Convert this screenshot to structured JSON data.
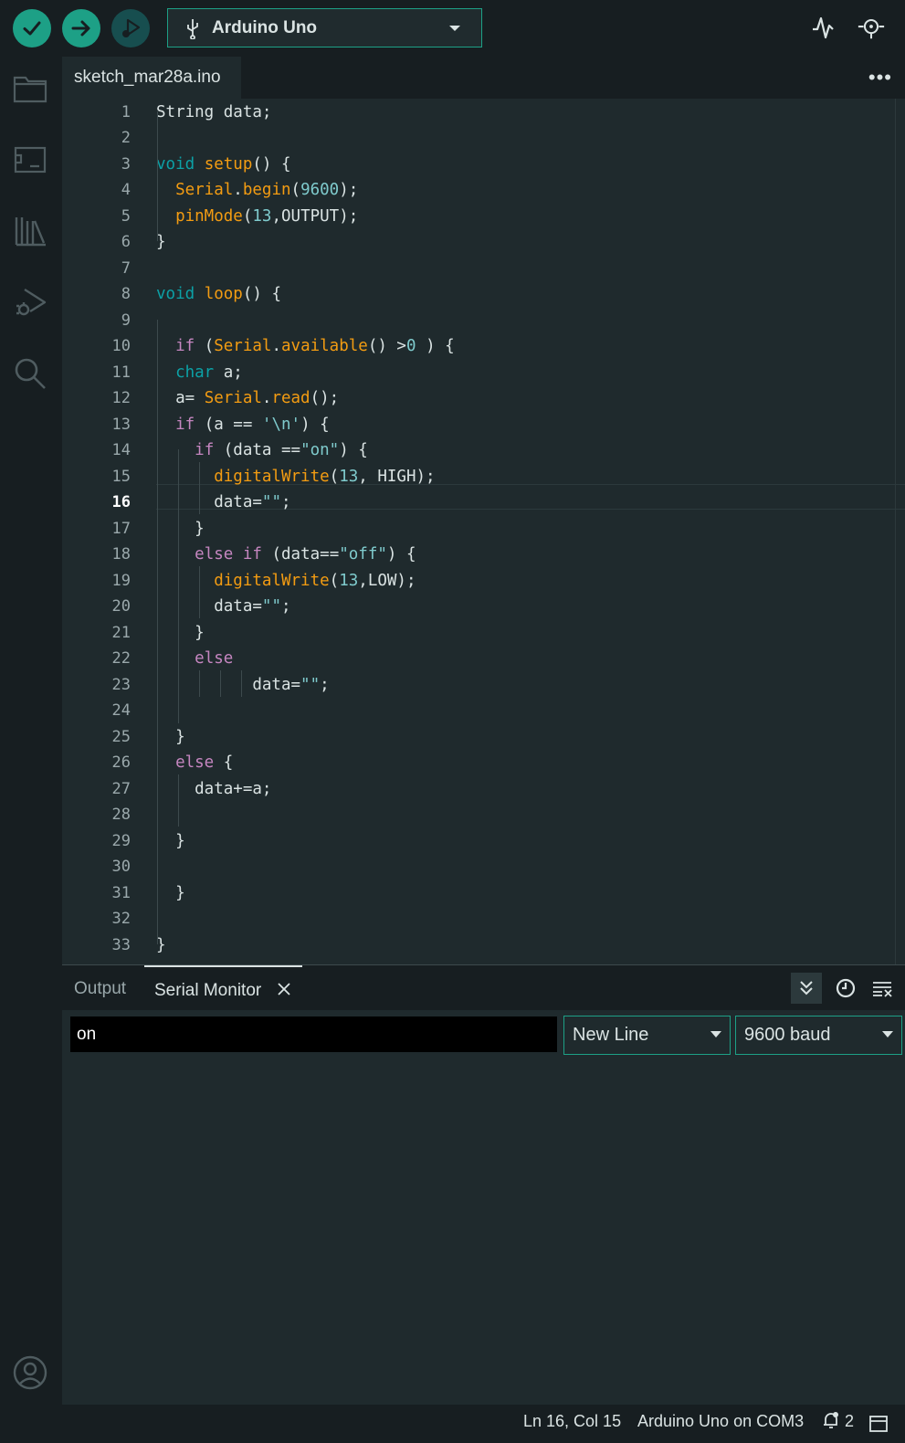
{
  "toolbar": {
    "verify_icon": "check-icon",
    "upload_icon": "arrow-right-icon",
    "debug_icon": "debug-icon",
    "board_icon": "usb-icon",
    "board_label": "Arduino Uno",
    "serial_plotter_icon": "serial-plotter-icon",
    "serial_monitor_icon": "serial-monitor-icon"
  },
  "sidebar": {
    "items": [
      {
        "icon": "folder-icon"
      },
      {
        "icon": "board-manager-icon"
      },
      {
        "icon": "library-icon"
      },
      {
        "icon": "debug-icon"
      },
      {
        "icon": "search-icon"
      }
    ],
    "profile_icon": "user-icon"
  },
  "editor": {
    "file_tab": "sketch_mar28a.ino",
    "more_label": "•••",
    "active_line": 16,
    "line_numbers": [
      "1",
      "2",
      "3",
      "4",
      "5",
      "6",
      "7",
      "8",
      "9",
      "10",
      "11",
      "12",
      "13",
      "14",
      "15",
      "16",
      "17",
      "18",
      "19",
      "20",
      "21",
      "22",
      "23",
      "24",
      "25",
      "26",
      "27",
      "28",
      "29",
      "30",
      "31",
      "32",
      "33"
    ],
    "lines": [
      [
        {
          "t": "String data;",
          "c": ""
        }
      ],
      [],
      [
        {
          "t": "void",
          "c": "t"
        },
        {
          "t": " ",
          "c": ""
        },
        {
          "t": "setup",
          "c": "f"
        },
        {
          "t": "() {",
          "c": ""
        }
      ],
      [
        {
          "t": "  ",
          "c": ""
        },
        {
          "t": "Serial",
          "c": "f"
        },
        {
          "t": ".",
          "c": ""
        },
        {
          "t": "begin",
          "c": "f"
        },
        {
          "t": "(",
          "c": ""
        },
        {
          "t": "9600",
          "c": "n"
        },
        {
          "t": ");",
          "c": ""
        }
      ],
      [
        {
          "t": "  ",
          "c": ""
        },
        {
          "t": "pinMode",
          "c": "f"
        },
        {
          "t": "(",
          "c": ""
        },
        {
          "t": "13",
          "c": "n"
        },
        {
          "t": ",OUTPUT);",
          "c": ""
        }
      ],
      [
        {
          "t": "}",
          "c": ""
        }
      ],
      [],
      [
        {
          "t": "void",
          "c": "t"
        },
        {
          "t": " ",
          "c": ""
        },
        {
          "t": "loop",
          "c": "f"
        },
        {
          "t": "() {",
          "c": ""
        }
      ],
      [],
      [
        {
          "t": "  ",
          "c": ""
        },
        {
          "t": "if",
          "c": "k"
        },
        {
          "t": " (",
          "c": ""
        },
        {
          "t": "Serial",
          "c": "f"
        },
        {
          "t": ".",
          "c": ""
        },
        {
          "t": "available",
          "c": "f"
        },
        {
          "t": "() >",
          "c": ""
        },
        {
          "t": "0",
          "c": "n"
        },
        {
          "t": " ) {",
          "c": ""
        }
      ],
      [
        {
          "t": "  ",
          "c": ""
        },
        {
          "t": "char",
          "c": "t"
        },
        {
          "t": " a;",
          "c": ""
        }
      ],
      [
        {
          "t": "  a= ",
          "c": ""
        },
        {
          "t": "Serial",
          "c": "f"
        },
        {
          "t": ".",
          "c": ""
        },
        {
          "t": "read",
          "c": "f"
        },
        {
          "t": "();",
          "c": ""
        }
      ],
      [
        {
          "t": "  ",
          "c": ""
        },
        {
          "t": "if",
          "c": "k"
        },
        {
          "t": " (a == ",
          "c": ""
        },
        {
          "t": "'\\n'",
          "c": "s"
        },
        {
          "t": ") {",
          "c": ""
        }
      ],
      [
        {
          "t": "    ",
          "c": ""
        },
        {
          "t": "if",
          "c": "k"
        },
        {
          "t": " (data ==",
          "c": ""
        },
        {
          "t": "\"on\"",
          "c": "s"
        },
        {
          "t": ") {",
          "c": ""
        }
      ],
      [
        {
          "t": "      ",
          "c": ""
        },
        {
          "t": "digitalWrite",
          "c": "f"
        },
        {
          "t": "(",
          "c": ""
        },
        {
          "t": "13",
          "c": "n"
        },
        {
          "t": ", HIGH);",
          "c": ""
        }
      ],
      [
        {
          "t": "      data=",
          "c": ""
        },
        {
          "t": "\"\"",
          "c": "s"
        },
        {
          "t": ";",
          "c": ""
        }
      ],
      [
        {
          "t": "    }",
          "c": ""
        }
      ],
      [
        {
          "t": "    ",
          "c": ""
        },
        {
          "t": "else",
          "c": "k"
        },
        {
          "t": " ",
          "c": ""
        },
        {
          "t": "if",
          "c": "k"
        },
        {
          "t": " (data==",
          "c": ""
        },
        {
          "t": "\"off\"",
          "c": "s"
        },
        {
          "t": ") {",
          "c": ""
        }
      ],
      [
        {
          "t": "      ",
          "c": ""
        },
        {
          "t": "digitalWrite",
          "c": "f"
        },
        {
          "t": "(",
          "c": ""
        },
        {
          "t": "13",
          "c": "n"
        },
        {
          "t": ",LOW);",
          "c": ""
        }
      ],
      [
        {
          "t": "      data=",
          "c": ""
        },
        {
          "t": "\"\"",
          "c": "s"
        },
        {
          "t": ";",
          "c": ""
        }
      ],
      [
        {
          "t": "    }",
          "c": ""
        }
      ],
      [
        {
          "t": "    ",
          "c": ""
        },
        {
          "t": "else",
          "c": "k"
        }
      ],
      [
        {
          "t": "          data=",
          "c": ""
        },
        {
          "t": "\"\"",
          "c": "s"
        },
        {
          "t": ";",
          "c": ""
        }
      ],
      [],
      [
        {
          "t": "  }",
          "c": ""
        }
      ],
      [
        {
          "t": "  ",
          "c": ""
        },
        {
          "t": "else",
          "c": "k"
        },
        {
          "t": " {",
          "c": ""
        }
      ],
      [
        {
          "t": "    data+=a;",
          "c": ""
        }
      ],
      [],
      [
        {
          "t": "  }",
          "c": ""
        }
      ],
      [],
      [
        {
          "t": "  }",
          "c": ""
        }
      ],
      [],
      [
        {
          "t": "}",
          "c": ""
        }
      ]
    ]
  },
  "panel": {
    "tabs": {
      "output": "Output",
      "serial_monitor": "Serial Monitor"
    },
    "close_icon": "close-icon",
    "autoscroll_icon": "autoscroll-icon",
    "timestamp_icon": "clock-icon",
    "clear_icon": "clear-output-icon",
    "message_value": "on",
    "line_ending": "New Line",
    "baud_rate": "9600 baud"
  },
  "status": {
    "cursor": "Ln 16, Col 15",
    "board": "Arduino Uno on COM3",
    "notifications": "2",
    "notification_icon": "bell-icon",
    "panel_toggle_icon": "panel-toggle-icon"
  },
  "colors": {
    "accent": "#1da086",
    "background": "#171e21",
    "editor_bg": "#1f2a2d",
    "keyword": "#c586c0",
    "type": "#0ca1a6",
    "function": "#f39c12",
    "number": "#7fcbcd"
  }
}
